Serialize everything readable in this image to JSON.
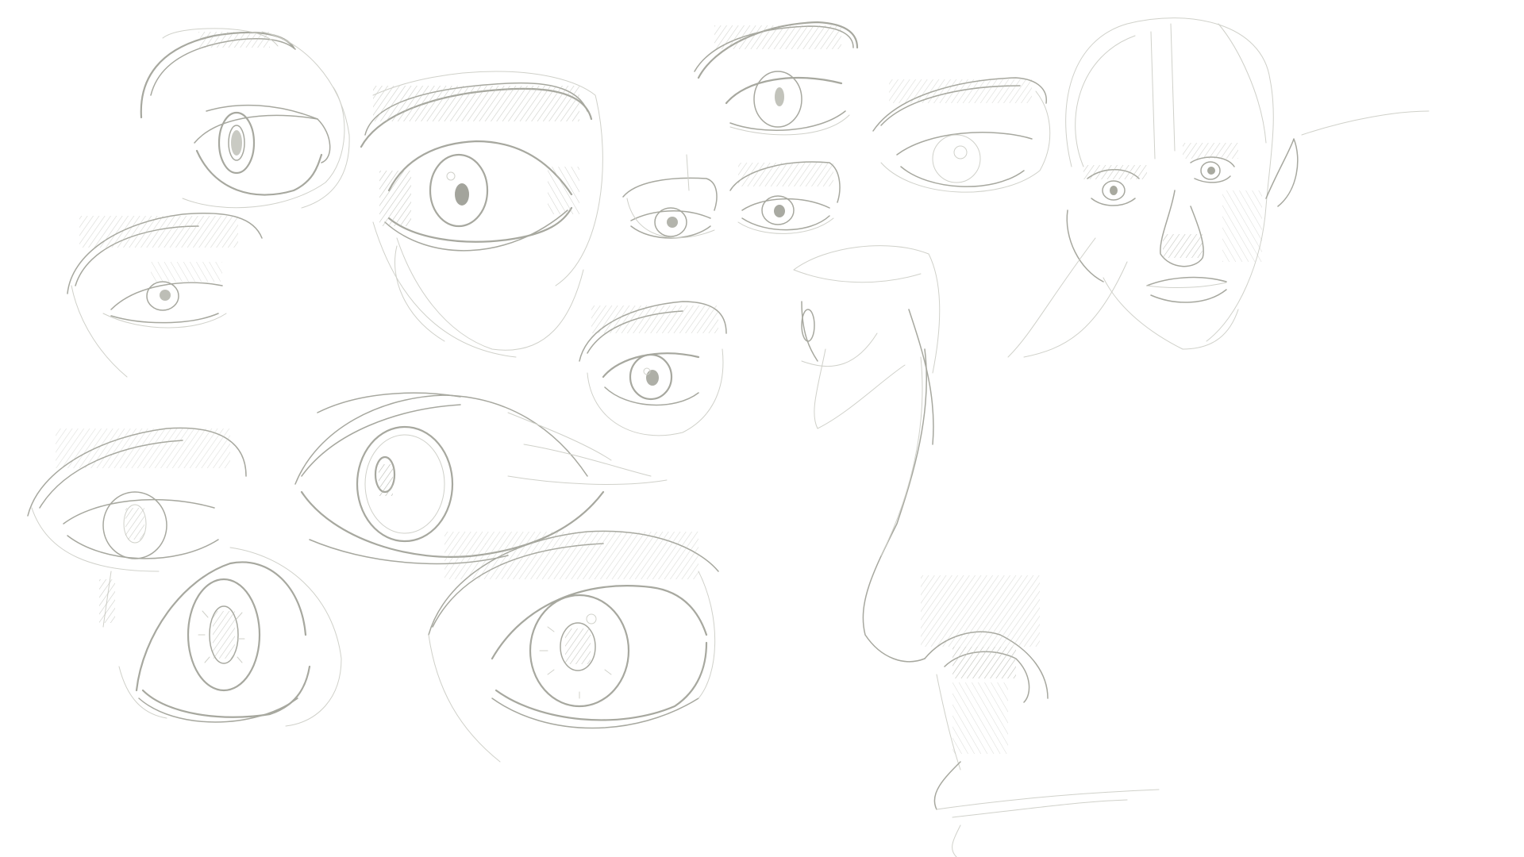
{
  "canvas": {
    "background_color": "#ffffff",
    "stroke_color_dark": "#a7a89f",
    "stroke_color_light": "#d0d1ca"
  },
  "sketches": [
    {
      "name": "eye-study-top-left"
    },
    {
      "name": "eye-study-large-shaded"
    },
    {
      "name": "eye-study-top-center"
    },
    {
      "name": "eye-study-small-pair"
    },
    {
      "name": "eye-study-top-right"
    },
    {
      "name": "face-portrait-study"
    },
    {
      "name": "eye-study-left-middle"
    },
    {
      "name": "eye-study-center"
    },
    {
      "name": "eye-study-large-stylized"
    },
    {
      "name": "eye-study-bottom-left"
    },
    {
      "name": "eye-study-bottom-left-large-iris"
    },
    {
      "name": "eye-study-bottom-center"
    },
    {
      "name": "profile-face-study"
    }
  ]
}
